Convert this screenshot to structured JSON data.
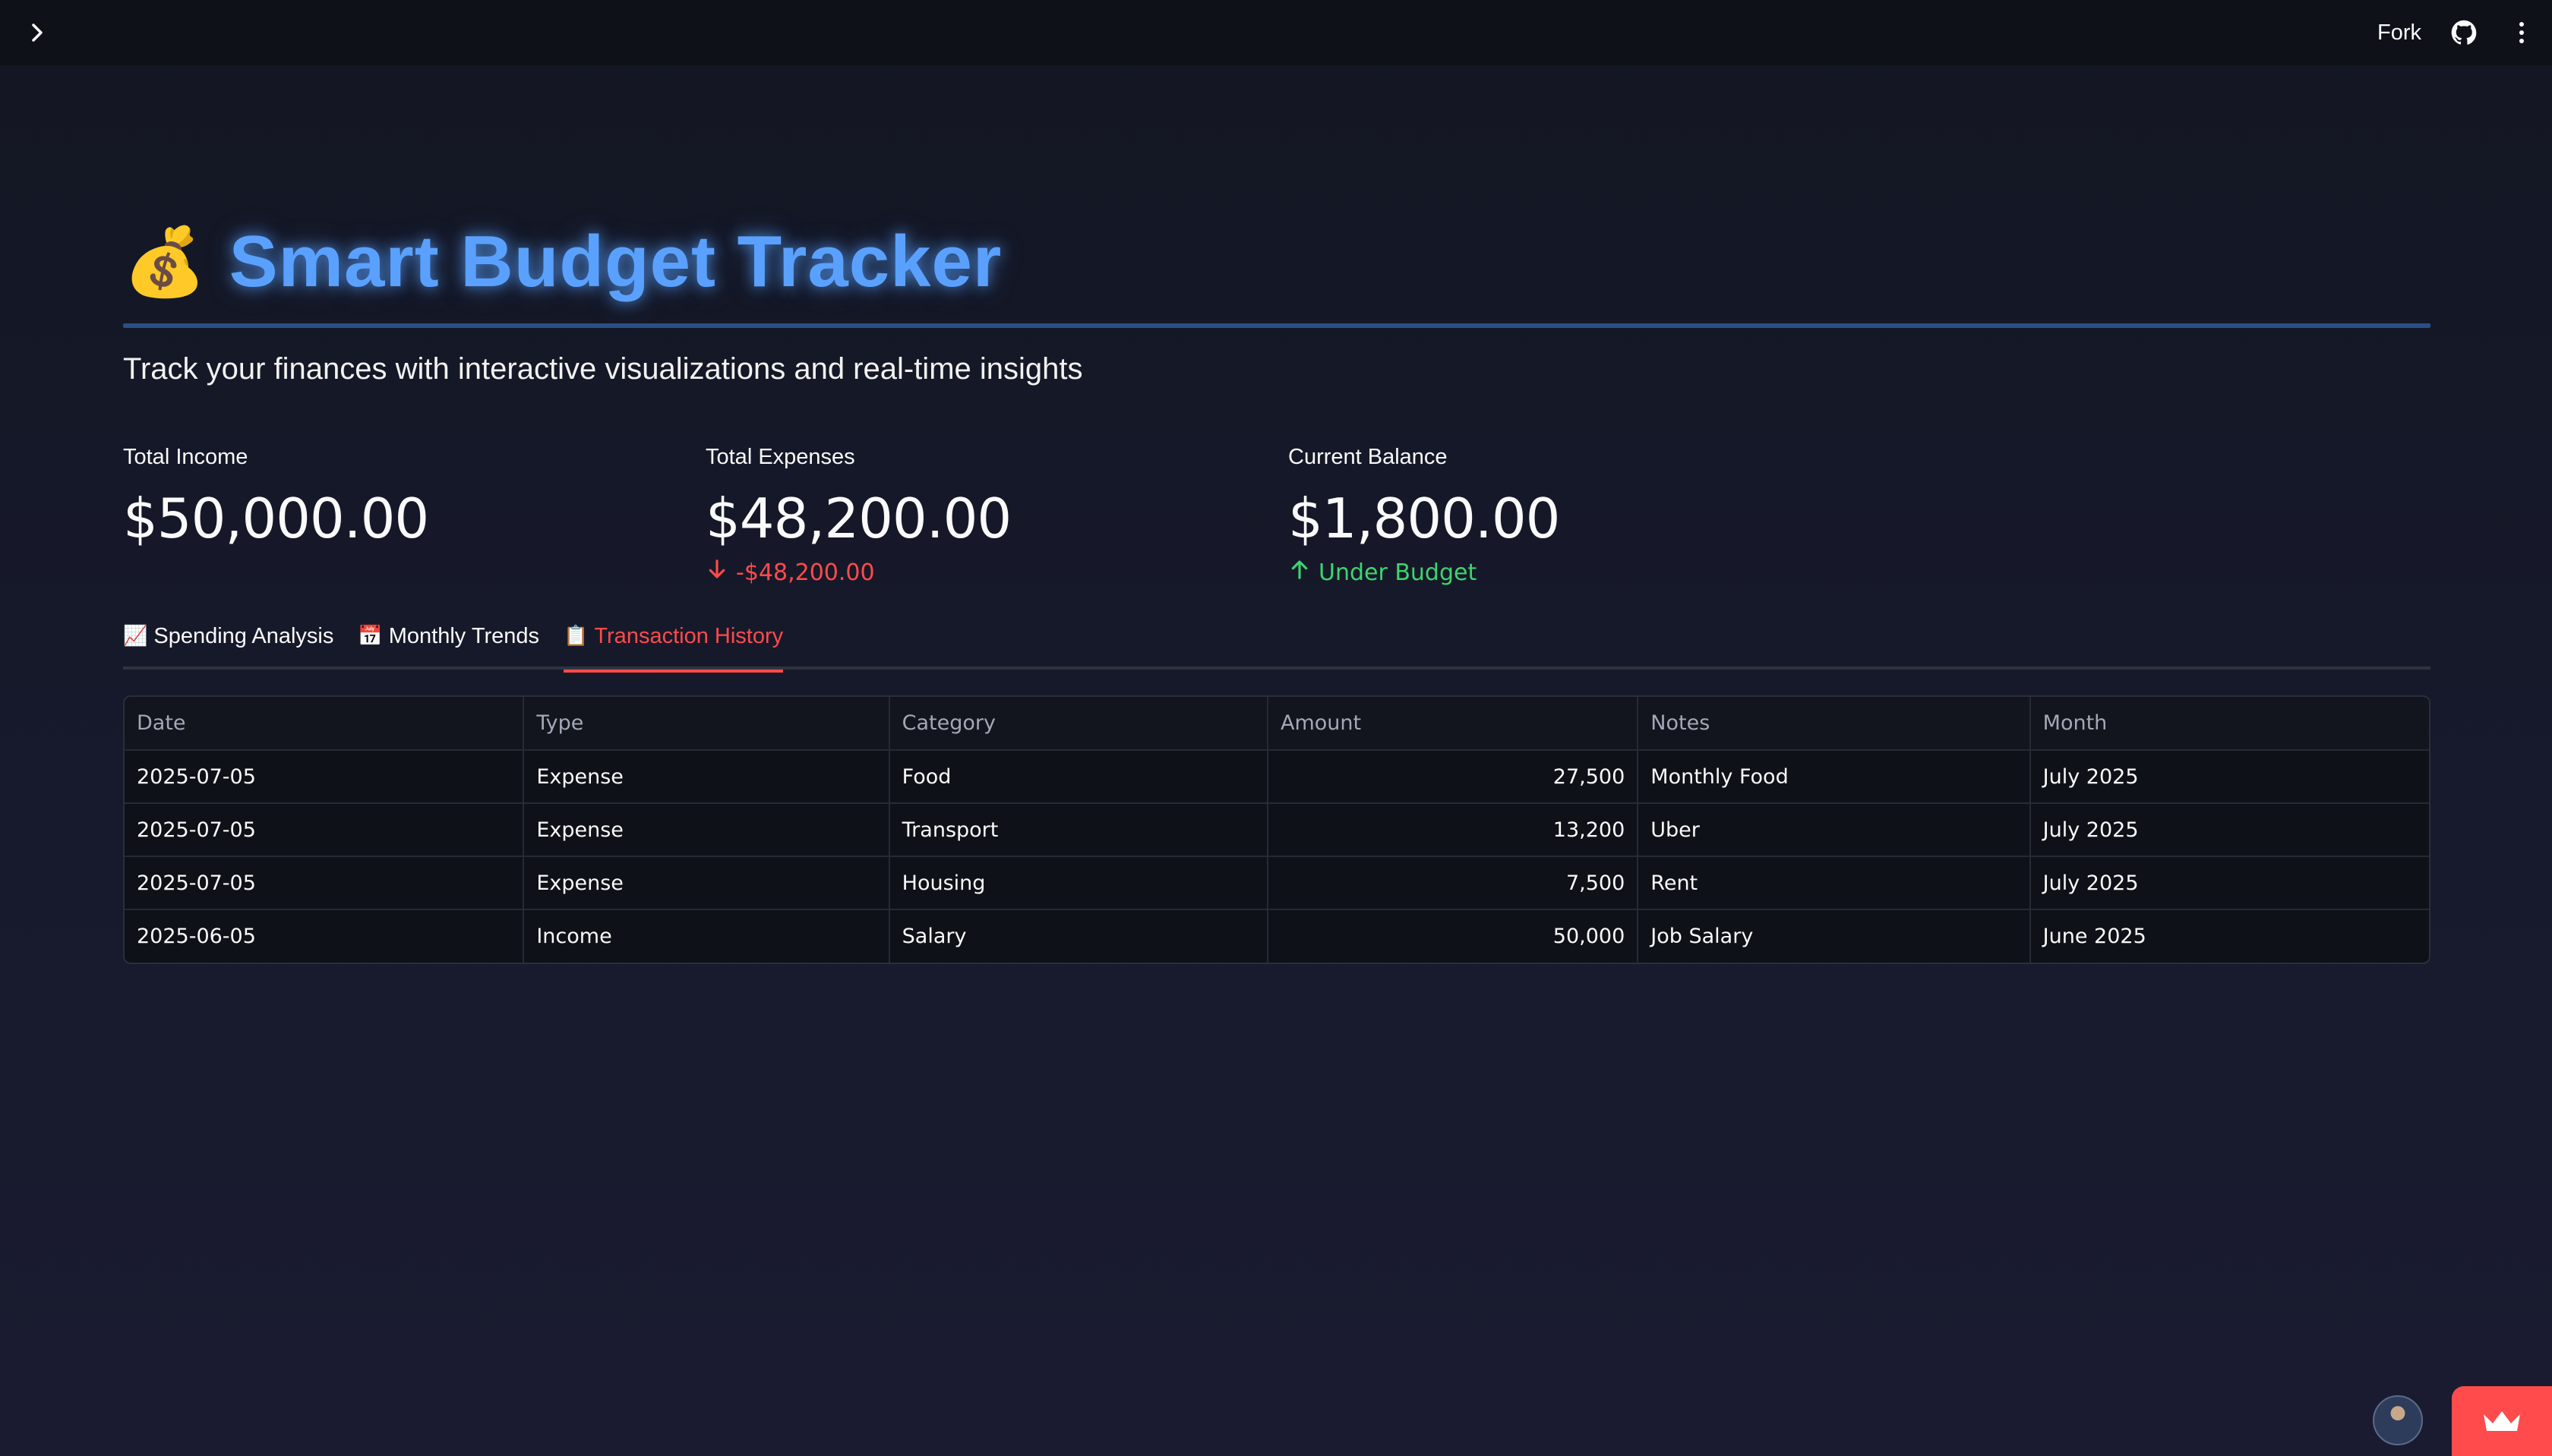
{
  "topbar": {
    "fork_label": "Fork",
    "icons": [
      "chevron-right-icon",
      "github-icon",
      "more-vert-icon"
    ]
  },
  "header": {
    "title_emoji": "💰",
    "title": "Smart Budget Tracker",
    "subtitle": "Track your finances with interactive visualizations and real-time insights"
  },
  "metrics": [
    {
      "label": "Total Income",
      "value": "$50,000.00",
      "delta": "",
      "delta_direction": ""
    },
    {
      "label": "Total Expenses",
      "value": "$48,200.00",
      "delta": "-$48,200.00",
      "delta_direction": "down"
    },
    {
      "label": "Current Balance",
      "value": "$1,800.00",
      "delta": "Under Budget",
      "delta_direction": "up"
    }
  ],
  "tabs": [
    {
      "icon": "📈",
      "label": "Spending Analysis",
      "active": false
    },
    {
      "icon": "📅",
      "label": "Monthly Trends",
      "active": false
    },
    {
      "icon": "📋",
      "label": "Transaction History",
      "active": true
    }
  ],
  "table": {
    "columns": [
      "Date",
      "Type",
      "Category",
      "Amount",
      "Notes",
      "Month"
    ],
    "rows": [
      [
        "2025-07-05",
        "Expense",
        "Food",
        "27,500",
        "Monthly Food",
        "July 2025"
      ],
      [
        "2025-07-05",
        "Expense",
        "Transport",
        "13,200",
        "Uber",
        "July 2025"
      ],
      [
        "2025-07-05",
        "Expense",
        "Housing",
        "7,500",
        "Rent",
        "July 2025"
      ],
      [
        "2025-06-05",
        "Income",
        "Salary",
        "50,000",
        "Job Salary",
        "June 2025"
      ]
    ]
  },
  "colors": {
    "accent": "#ff4b4b",
    "title": "#5aa1ff",
    "positive": "#3dd56d"
  }
}
